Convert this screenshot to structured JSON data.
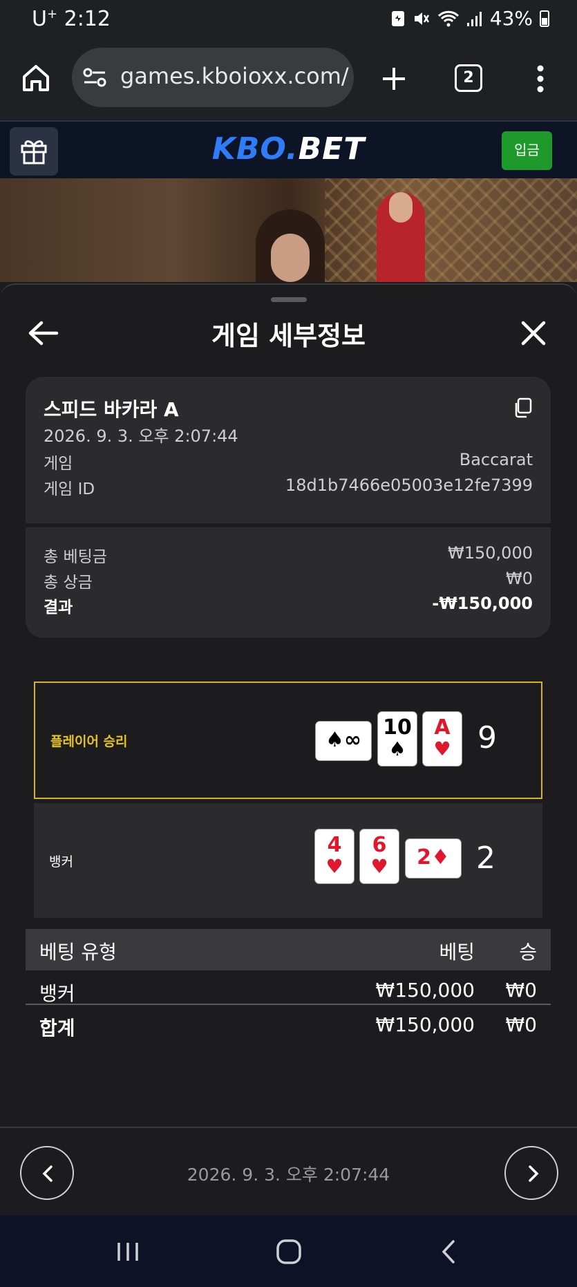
{
  "status_bar": {
    "carrier": "U",
    "carrier_sup": "+",
    "time": "2:12",
    "battery": "43%"
  },
  "browser": {
    "url": "games.kboioxx.com/",
    "tab_count": "2"
  },
  "site": {
    "logo_part1": "KBO.",
    "logo_part2": "BET",
    "deposit_label": "입금"
  },
  "modal": {
    "title": "게임 세부정보",
    "game_name": "스피드 바카라 A",
    "game_time": "2026. 9. 3. 오후 2:07:44",
    "rows": [
      {
        "label": "게임",
        "value": "Baccarat"
      },
      {
        "label": "게임 ID",
        "value": "18d1b7466e05003e12fe7399"
      }
    ],
    "totals": [
      {
        "label": "총 베팅금",
        "value": "₩150,000"
      },
      {
        "label": "총 상금",
        "value": "₩0"
      },
      {
        "label": "결과",
        "value": "-₩150,000"
      }
    ]
  },
  "results": {
    "player": {
      "label": "플레이어 승리",
      "score": "9",
      "cards": [
        {
          "rank": "∞",
          "suit": "♠",
          "color": "#000000"
        },
        {
          "rank": "10",
          "suit": "♠",
          "color": "#000000"
        },
        {
          "rank": "A",
          "suit": "♥",
          "color": "#e0182d"
        }
      ]
    },
    "banker": {
      "label": "뱅커",
      "score": "2",
      "cards": [
        {
          "rank": "4",
          "suit": "♥",
          "color": "#e0182d"
        },
        {
          "rank": "6",
          "suit": "♥",
          "color": "#e0182d"
        },
        {
          "rank": "2",
          "suit": "♦",
          "color": "#e0182d"
        }
      ]
    }
  },
  "bet_table": {
    "headers": {
      "type": "베팅 유형",
      "bet": "베팅",
      "win": "승"
    },
    "rows": [
      {
        "type": "뱅커",
        "bet": "₩150,000",
        "win": "₩0"
      }
    ],
    "total": {
      "type": "합계",
      "bet": "₩150,000",
      "win": "₩0"
    }
  },
  "footer": {
    "time": "2026. 9. 3. 오후 2:07:44"
  },
  "colors": {
    "accent_gold": "#d9b21c",
    "deposit_green": "#1e9a2c",
    "logo_blue": "#2f7df6"
  }
}
